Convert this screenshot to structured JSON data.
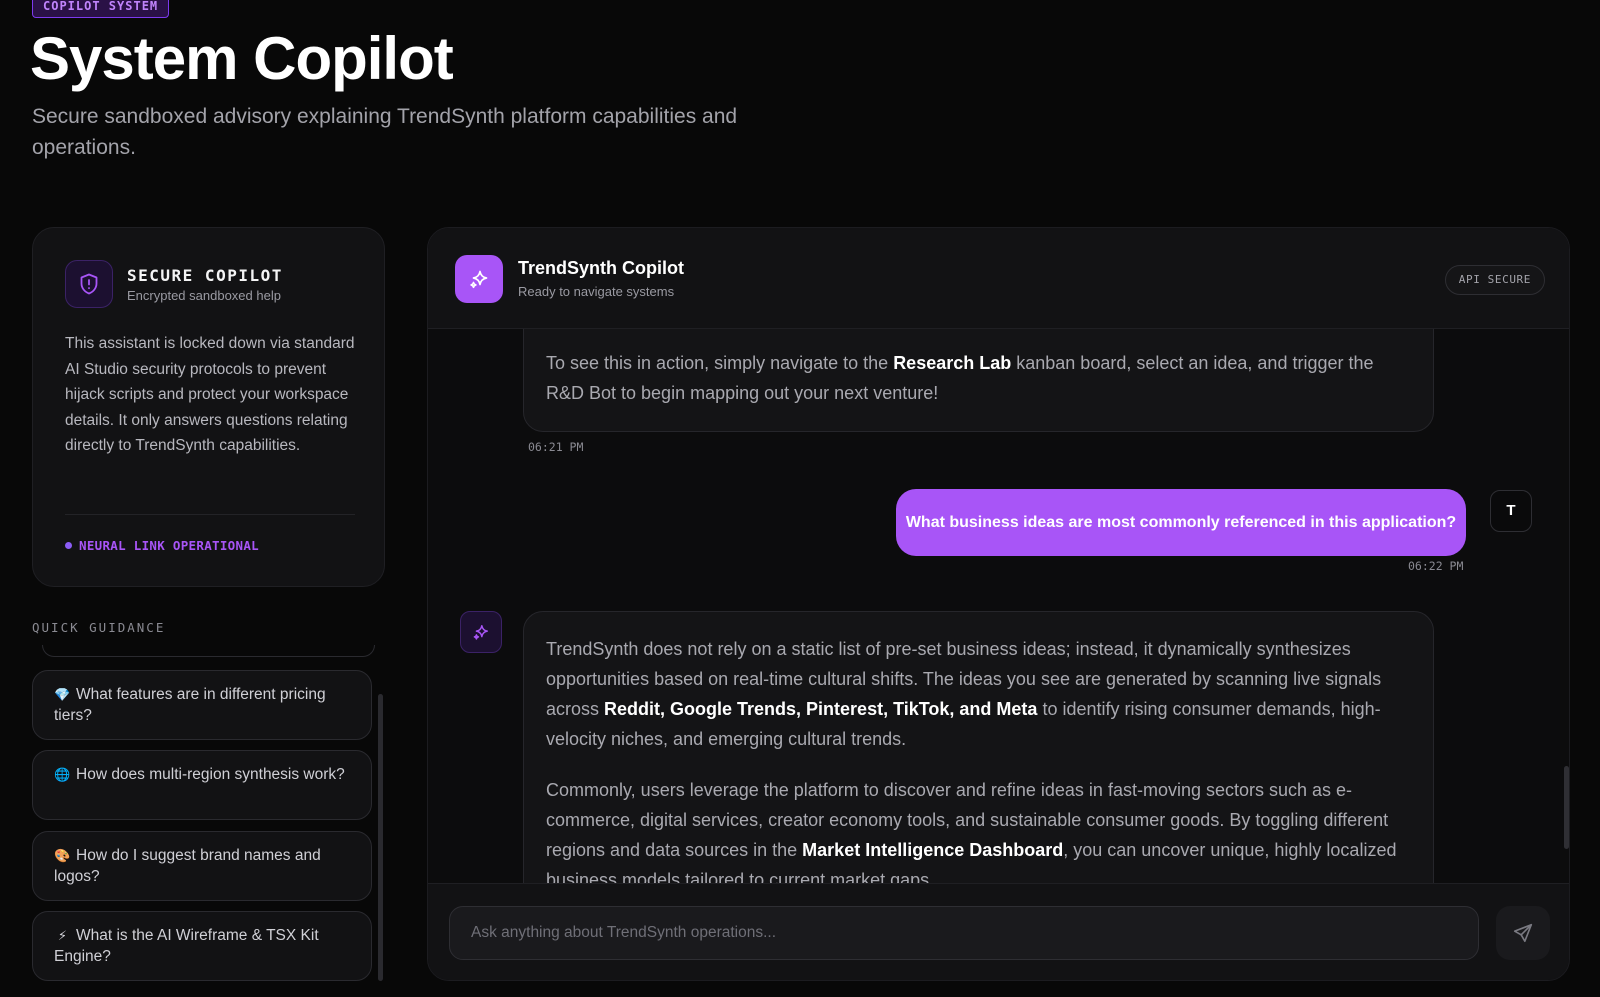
{
  "page": {
    "badge": "COPILOT SYSTEM",
    "title": "System Copilot",
    "subtitle": "Secure sandboxed advisory explaining TrendSynth platform capabilities and operations."
  },
  "secure_card": {
    "icon": "shield-icon",
    "title": "SECURE COPILOT",
    "subtitle": "Encrypted sandboxed help",
    "body": "This assistant is locked down via standard AI Studio security protocols to prevent hijack scripts and protect your workspace details. It only answers questions relating directly to TrendSynth capabilities.",
    "status": "NEURAL LINK OPERATIONAL"
  },
  "quick_guidance": {
    "label": "QUICK GUIDANCE",
    "items": [
      {
        "emoji": "💎",
        "text": "What features are in different pricing tiers?"
      },
      {
        "emoji": "🌐",
        "text": "How does multi-region synthesis work?"
      },
      {
        "emoji": "🎨",
        "text": "How do I suggest brand names and logos?"
      },
      {
        "emoji": "⚡",
        "text": "What is the AI Wireframe & TSX Kit Engine?"
      }
    ]
  },
  "chat": {
    "header": {
      "icon": "sparkles-icon",
      "name": "TrendSynth Copilot",
      "status": "Ready to navigate systems",
      "badge": "API SECURE"
    },
    "messages": [
      {
        "role": "bot",
        "parts": [
          {
            "t": "To see this in action, simply navigate to the "
          },
          {
            "t": "Research Lab",
            "b": true
          },
          {
            "t": " kanban board, select an idea, and trigger the R&D Bot to begin mapping out your next venture!"
          }
        ],
        "time": "06:21 PM"
      },
      {
        "role": "user",
        "avatar": "T",
        "text": "What business ideas are most commonly referenced in this application?",
        "time": "06:22 PM"
      },
      {
        "role": "bot",
        "paragraphs": [
          [
            {
              "t": "TrendSynth does not rely on a static list of pre-set business ideas; instead, it dynamically synthesizes opportunities based on real-time cultural shifts. The ideas you see are generated by scanning live signals across "
            },
            {
              "t": "Reddit, Google Trends, Pinterest, TikTok, and Meta",
              "b": true
            },
            {
              "t": " to identify rising consumer demands, high-velocity niches, and emerging cultural trends."
            }
          ],
          [
            {
              "t": "Commonly, users leverage the platform to discover and refine ideas in fast-moving sectors such as e-commerce, digital services, creator economy tools, and sustainable consumer goods. By toggling different regions and data sources in the "
            },
            {
              "t": "Market Intelligence Dashboard",
              "b": true
            },
            {
              "t": ", you can uncover unique, highly localized business models tailored to current market gaps."
            }
          ]
        ]
      }
    ],
    "input": {
      "placeholder": "Ask anything about TrendSynth operations...",
      "value": ""
    },
    "send_icon": "send-icon"
  },
  "colors": {
    "accent": "#a855f7",
    "background": "#080808",
    "card": "#121214"
  }
}
